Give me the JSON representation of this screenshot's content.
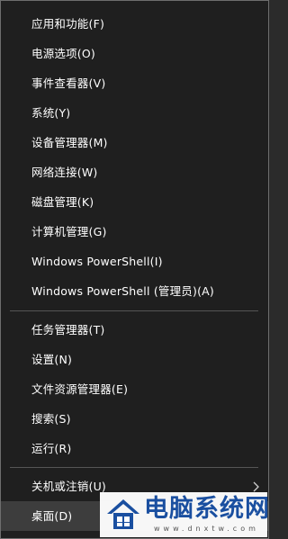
{
  "menu": {
    "items": [
      {
        "label": "应用和功能(F)"
      },
      {
        "label": "电源选项(O)"
      },
      {
        "label": "事件查看器(V)"
      },
      {
        "label": "系统(Y)"
      },
      {
        "label": "设备管理器(M)"
      },
      {
        "label": "网络连接(W)"
      },
      {
        "label": "磁盘管理(K)"
      },
      {
        "label": "计算机管理(G)"
      },
      {
        "label": "Windows PowerShell(I)"
      },
      {
        "label": "Windows PowerShell (管理员)(A)"
      },
      {
        "label": "任务管理器(T)"
      },
      {
        "label": "设置(N)"
      },
      {
        "label": "文件资源管理器(E)"
      },
      {
        "label": "搜索(S)"
      },
      {
        "label": "运行(R)"
      },
      {
        "label": "关机或注销(U)",
        "submenu": true
      },
      {
        "label": "桌面(D)",
        "highlighted": true
      }
    ]
  },
  "watermark": {
    "title": "电脑系统网",
    "url": "www.dnxtw.com"
  },
  "colors": {
    "menu_bg": "#1f1f1f",
    "text": "#ffffff",
    "highlight": "#3d3d3d",
    "separator": "#555555",
    "watermark_blue": "#1a4fa0"
  }
}
